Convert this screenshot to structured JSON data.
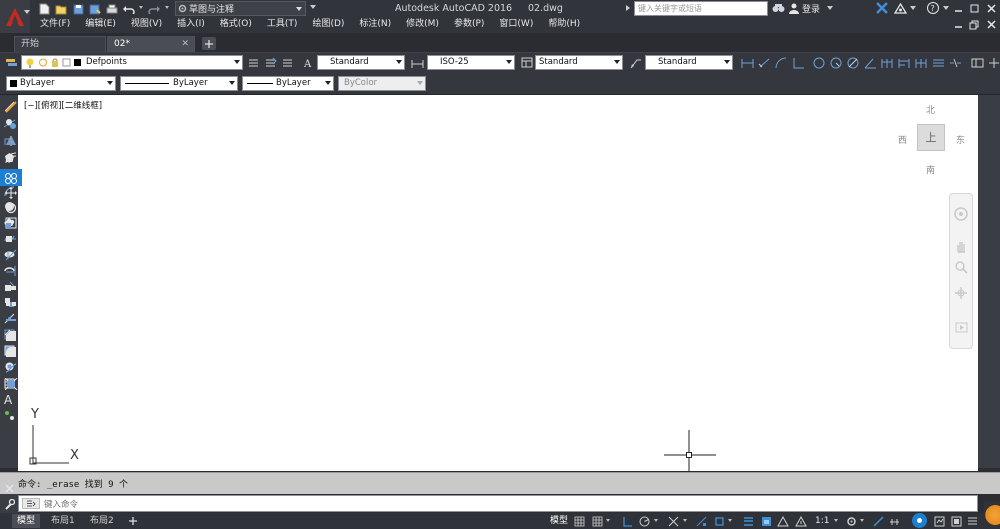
{
  "titlebar": {
    "app_title": "Autodesk AutoCAD 2016",
    "doc_name": "02.dwg",
    "workspace": "草图与注释",
    "search_placeholder": "键入关键字或短语",
    "login": "登录"
  },
  "menus": [
    "文件(F)",
    "编辑(E)",
    "视图(V)",
    "插入(I)",
    "格式(O)",
    "工具(T)",
    "绘图(D)",
    "标注(N)",
    "修改(M)",
    "参数(P)",
    "窗口(W)",
    "帮助(H)"
  ],
  "tabs": [
    {
      "label": "开始",
      "active": false
    },
    {
      "label": "02*",
      "active": true
    }
  ],
  "toolbar_row1": {
    "layer": "Defpoints",
    "text_style": "Standard",
    "dim_style": "ISO-25",
    "table_style": "Standard",
    "mleader_style": "Standard"
  },
  "toolbar_row2": {
    "color": "ByLayer",
    "linetype": "ByLayer",
    "lineweight": "ByLayer",
    "plotstyle": "ByColor"
  },
  "viewport_label": "[−][俯视][二维线框]",
  "viewcube": {
    "top": "上",
    "north": "北",
    "south": "南",
    "east": "东",
    "west": "西"
  },
  "ucs": {
    "x": "X",
    "y": "Y"
  },
  "command": {
    "history": "命令: _erase 找到 9 个",
    "placeholder": "键入命令"
  },
  "layout_tabs": [
    "模型",
    "布局1",
    "布局2"
  ],
  "status": {
    "model": "模型",
    "scale": "1:1"
  },
  "colors": {
    "accent": "#1c7fd1",
    "brand_red": "#c8281e",
    "canvas": "#ffffff",
    "chrome": "#34373d"
  }
}
